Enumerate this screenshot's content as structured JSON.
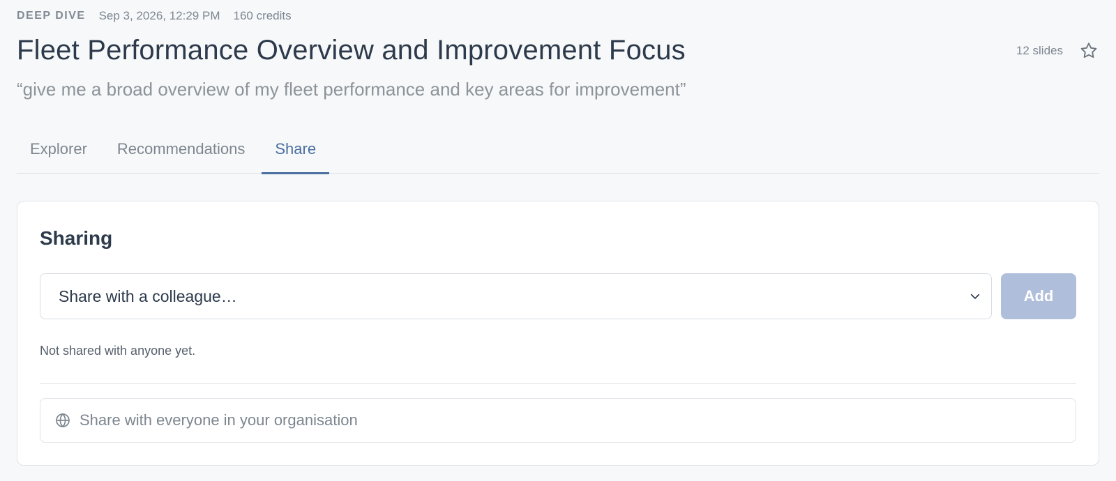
{
  "header": {
    "kind": "DEEP DIVE",
    "date": "Sep 3, 2026, 12:29 PM",
    "credits": "160 credits",
    "title": "Fleet Performance Overview and Improvement Focus",
    "slide_count": "12 slides",
    "prompt": "“give me a broad overview of my fleet performance and key areas for improvement”"
  },
  "tabs": [
    {
      "label": "Explorer"
    },
    {
      "label": "Recommendations"
    },
    {
      "label": "Share",
      "active": true
    }
  ],
  "sharing": {
    "title": "Sharing",
    "select_placeholder": "Share with a colleague…",
    "add_label": "Add",
    "empty_note": "Not shared with anyone yet.",
    "org_share_label": "Share with everyone in your organisation"
  },
  "icons": {
    "favorite": "star-icon",
    "dropdown": "chevron-down-icon",
    "org": "globe-icon"
  },
  "colors": {
    "accent": "#4a6fa1",
    "add_button_disabled": "#aebedb"
  }
}
